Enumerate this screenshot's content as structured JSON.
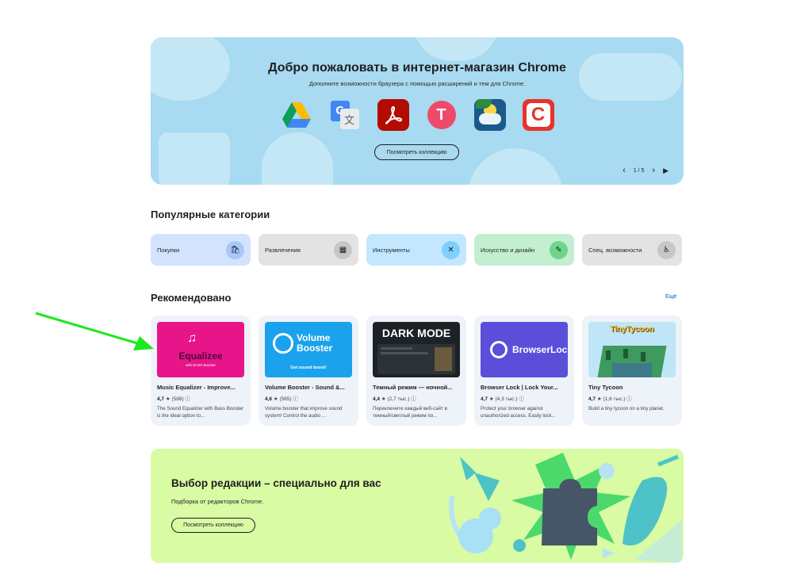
{
  "hero": {
    "title": "Добро пожаловать в интернет-магазин Chrome",
    "subtitle": "Дополните возможности браузера с помощью расширений и тем для Chrome.",
    "button_label": "Посмотреть коллекцию",
    "page_indicator": "1 / 5",
    "icons": [
      "google-drive-icon",
      "google-translate-icon",
      "adobe-acrobat-icon",
      "t-app-icon",
      "weather-icon",
      "c-app-icon"
    ]
  },
  "categories": {
    "title": "Популярные категории",
    "items": [
      {
        "label": "Покупки",
        "icon": "shopping-bag-icon",
        "bg": "#d3e3fd",
        "iconbg": "#a8c7fa"
      },
      {
        "label": "Развлечения",
        "icon": "calendar-icon",
        "bg": "#e3e3e3",
        "iconbg": "#c7c7c7"
      },
      {
        "label": "Инструменты",
        "icon": "tools-icon",
        "bg": "#c2e7ff",
        "iconbg": "#7fcfff"
      },
      {
        "label": "Искусство и дизайн",
        "icon": "pencil-icon",
        "bg": "#c4eed0",
        "iconbg": "#6dd58c"
      },
      {
        "label": "Спец. возможности",
        "icon": "accessibility-icon",
        "bg": "#e3e3e3",
        "iconbg": "#c7c7c7"
      }
    ]
  },
  "recommended": {
    "title": "Рекомендовано",
    "more_label": "Ещё",
    "items": [
      {
        "title": "Music Equalizer - Improve...",
        "rating": "4,7",
        "reviews": "(588)",
        "desc": "The Sound Equalizer with Bass Booster is the ideal option to...",
        "thumb_text": "Equalizee",
        "thumb_sub": "with BASS Booster"
      },
      {
        "title": "Volume Booster - Sound &...",
        "rating": "4,6",
        "reviews": "(565)",
        "desc": "Volume booster that improve sound system! Control the audio ...",
        "thumb_text": "Volume Booster",
        "thumb_sub": "Get sound boost!"
      },
      {
        "title": "Темный режим — ночной...",
        "rating": "4,4",
        "reviews": "(2,7 тыс.)",
        "desc": "Переключите каждый веб-сайт в темный/светлый режим по...",
        "thumb_text": "DARK MODE",
        "thumb_sub": ""
      },
      {
        "title": "Browser Lock | Lock Your...",
        "rating": "4,7",
        "reviews": "(4,3 тыс.)",
        "desc": "Protect your browser against unauthorized access. Easily lock...",
        "thumb_text": "BrowserLock",
        "thumb_sub": ""
      },
      {
        "title": "Tiny Tycoon",
        "rating": "4,7",
        "reviews": "(1,6 тыс.)",
        "desc": "Build a tiny tycoon on a tiny planet.",
        "thumb_text": "TinyTycoon",
        "thumb_sub": ""
      }
    ]
  },
  "editor": {
    "title": "Выбор редакции – специально для вас",
    "subtitle": "Подборка от редакторов Chrome.",
    "button_label": "Посмотреть коллекцию"
  },
  "annotation": {
    "color": "#1ee81e"
  }
}
